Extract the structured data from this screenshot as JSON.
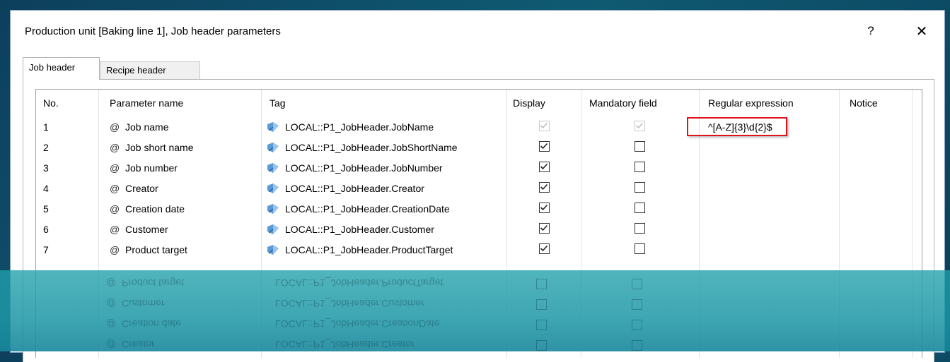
{
  "window": {
    "title": "Production unit [Baking line 1], Job header parameters",
    "help_label": "?",
    "close_label": "✕"
  },
  "tabs": [
    {
      "label": "Job header",
      "active": true
    },
    {
      "label": "Recipe header",
      "active": false
    }
  ],
  "table": {
    "columns": [
      "No.",
      "Parameter name",
      "Tag",
      "Display",
      "Mandatory field",
      "Regular expression",
      "Notice"
    ],
    "rows": [
      {
        "no": "1",
        "name": "Job name",
        "tag": "LOCAL::P1_JobHeader.JobName",
        "display": true,
        "mandatory": true,
        "locked": true,
        "regex": "^[A-Z]{3}\\d{2}$",
        "notice": ""
      },
      {
        "no": "2",
        "name": "Job short name",
        "tag": "LOCAL::P1_JobHeader.JobShortName",
        "display": true,
        "mandatory": false,
        "locked": false,
        "regex": "",
        "notice": ""
      },
      {
        "no": "3",
        "name": "Job number",
        "tag": "LOCAL::P1_JobHeader.JobNumber",
        "display": true,
        "mandatory": false,
        "locked": false,
        "regex": "",
        "notice": ""
      },
      {
        "no": "4",
        "name": "Creator",
        "tag": "LOCAL::P1_JobHeader.Creator",
        "display": true,
        "mandatory": false,
        "locked": false,
        "regex": "",
        "notice": ""
      },
      {
        "no": "5",
        "name": "Creation date",
        "tag": "LOCAL::P1_JobHeader.CreationDate",
        "display": true,
        "mandatory": false,
        "locked": false,
        "regex": "",
        "notice": ""
      },
      {
        "no": "6",
        "name": "Customer",
        "tag": "LOCAL::P1_JobHeader.Customer",
        "display": true,
        "mandatory": false,
        "locked": false,
        "regex": "",
        "notice": ""
      },
      {
        "no": "7",
        "name": "Product target",
        "tag": "LOCAL::P1_JobHeader.ProductTarget",
        "display": true,
        "mandatory": false,
        "locked": false,
        "regex": "",
        "notice": ""
      }
    ],
    "param_prefix": "@"
  },
  "colors": {
    "highlight": "#e2121b",
    "tag_icon": "#4a90d9",
    "background": "#0f5a72"
  }
}
